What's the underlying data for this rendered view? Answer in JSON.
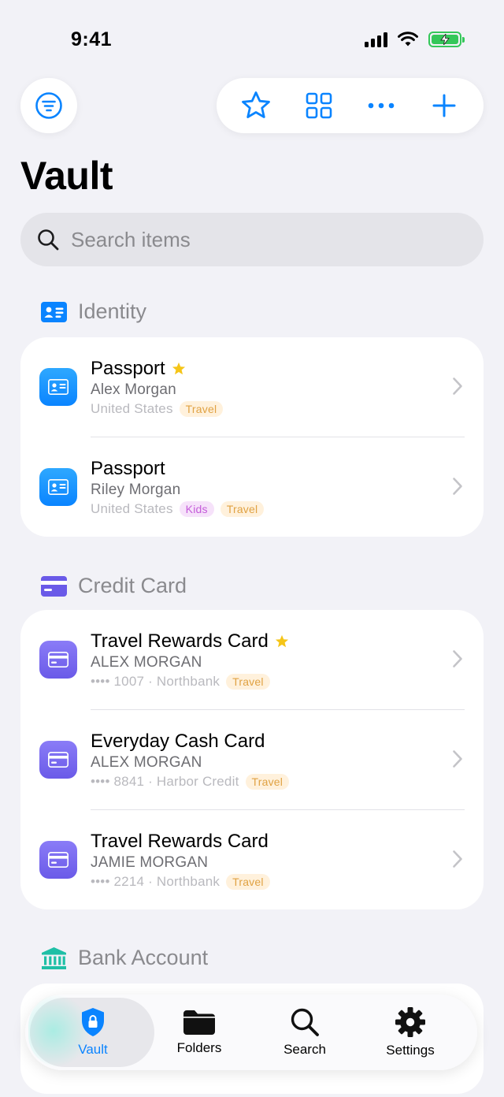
{
  "status_bar": {
    "time": "9:41"
  },
  "page": {
    "title": "Vault"
  },
  "search": {
    "placeholder": "Search items"
  },
  "sections": {
    "identity": {
      "label": "Identity",
      "items": [
        {
          "title": "Passport",
          "subtitle": "Alex Morgan",
          "meta": "United States",
          "tags": [
            "Travel"
          ],
          "favorite": true
        },
        {
          "title": "Passport",
          "subtitle": "Riley Morgan",
          "meta": "United States",
          "tags": [
            "Kids",
            "Travel"
          ],
          "favorite": false
        }
      ]
    },
    "credit_card": {
      "label": "Credit Card",
      "items": [
        {
          "title": "Travel Rewards Card",
          "subtitle": "ALEX MORGAN",
          "meta": "•••• 1007 · Northbank",
          "tags": [
            "Travel"
          ],
          "favorite": true
        },
        {
          "title": "Everyday Cash Card",
          "subtitle": "ALEX MORGAN",
          "meta": "•••• 8841 · Harbor Credit",
          "tags": [
            "Travel"
          ],
          "favorite": false
        },
        {
          "title": "Travel Rewards Card",
          "subtitle": "JAMIE MORGAN",
          "meta": "•••• 2214 · Northbank",
          "tags": [
            "Travel"
          ],
          "favorite": false
        }
      ]
    },
    "bank_account": {
      "label": "Bank Account"
    }
  },
  "tab_bar": {
    "tabs": [
      {
        "label": "Vault",
        "active": true
      },
      {
        "label": "Folders",
        "active": false
      },
      {
        "label": "Search",
        "active": false
      },
      {
        "label": "Settings",
        "active": false
      }
    ]
  },
  "colors": {
    "accent": "#0a84ff",
    "identity_icon": "#0a84ff",
    "card_icon": "#6a5ae8",
    "bank_icon": "#1fbfa6",
    "favorite_star": "#f5c518",
    "battery": "#34c759"
  }
}
